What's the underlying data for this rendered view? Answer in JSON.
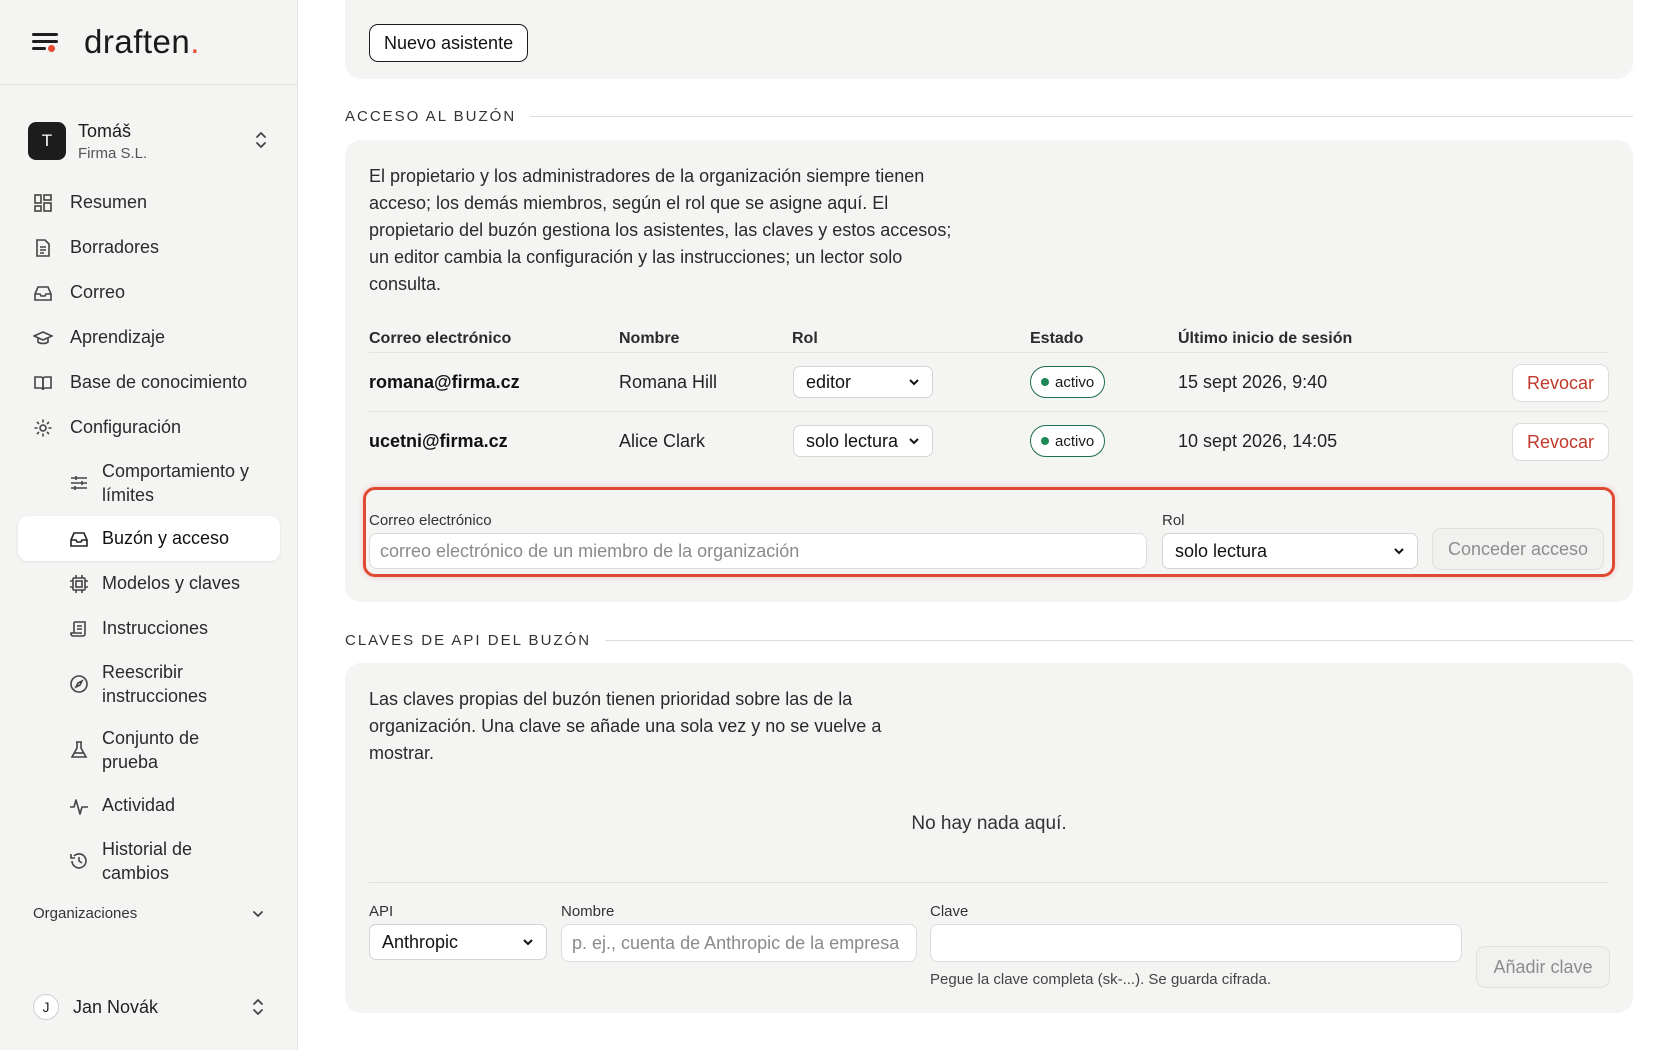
{
  "brand": {
    "logo_text": "draften",
    "logo_dot": ".",
    "accent": "#e8492f"
  },
  "account": {
    "initial": "T",
    "name": "Tomáš",
    "org": "Firma S.L."
  },
  "nav": {
    "items": [
      {
        "label": "Resumen",
        "icon": "dashboard-icon"
      },
      {
        "label": "Borradores",
        "icon": "document-icon"
      },
      {
        "label": "Correo",
        "icon": "inbox-icon"
      },
      {
        "label": "Aprendizaje",
        "icon": "graduation-cap-icon"
      },
      {
        "label": "Base de conocimiento",
        "icon": "book-icon"
      },
      {
        "label": "Configuración",
        "icon": "gear-icon"
      }
    ],
    "sub_items": [
      {
        "label": "Comportamiento y límites",
        "icon": "sliders-icon"
      },
      {
        "label": "Buzón y acceso",
        "icon": "inbox-icon"
      },
      {
        "label": "Modelos y claves",
        "icon": "chip-icon"
      },
      {
        "label": "Instrucciones",
        "icon": "scroll-icon"
      },
      {
        "label": "Reescribir instrucciones",
        "icon": "compass-icon"
      },
      {
        "label": "Conjunto de prueba",
        "icon": "flask-icon"
      },
      {
        "label": "Actividad",
        "icon": "activity-icon"
      },
      {
        "label": "Historial de cambios",
        "icon": "history-icon"
      }
    ],
    "organizations_label": "Organizaciones"
  },
  "user": {
    "initial": "J",
    "name": "Jan Novák"
  },
  "assistants": {
    "new_button": "Nuevo asistente"
  },
  "mailbox_access": {
    "title": "ACCESO AL BUZÓN",
    "description": "El propietario y los administradores de la organización siempre tienen acceso; los demás miembros, según el rol que se asigne aquí. El propietario del buzón gestiona los asistentes, las claves y estos accesos; un editor cambia la configuración y las instrucciones; un lector solo consulta.",
    "columns": [
      "Correo electrónico",
      "Nombre",
      "Rol",
      "Estado",
      "Último inicio de sesión"
    ],
    "rows": [
      {
        "email": "romana@firma.cz",
        "name": "Romana Hill",
        "role": "editor",
        "status": "activo",
        "last_login": "15 sept 2026, 9:40",
        "action": "Revocar"
      },
      {
        "email": "ucetni@firma.cz",
        "name": "Alice Clark",
        "role": "solo lectura",
        "status": "activo",
        "last_login": "10 sept 2026, 14:05",
        "action": "Revocar"
      }
    ],
    "grant_form": {
      "email_label": "Correo electrónico",
      "email_placeholder": "correo electrónico de un miembro de la organización",
      "role_label": "Rol",
      "role_value": "solo lectura",
      "submit": "Conceder acceso"
    }
  },
  "api_keys": {
    "title": "CLAVES DE API DEL BUZÓN",
    "description": "Las claves propias del buzón tienen prioridad sobre las de la organización. Una clave se añade una sola vez y no se vuelve a mostrar.",
    "empty": "No hay nada aquí.",
    "form": {
      "api_label": "API",
      "api_value": "Anthropic",
      "name_label": "Nombre",
      "name_placeholder": "p. ej., cuenta de Anthropic de la empresa",
      "key_label": "Clave",
      "key_hint": "Pegue la clave completa (sk-...). Se guarda cifrada.",
      "submit": "Añadir clave"
    }
  },
  "colors": {
    "status_green": "#1d8a56",
    "revoke_red": "#c0392b",
    "highlight": "#e04a32"
  }
}
